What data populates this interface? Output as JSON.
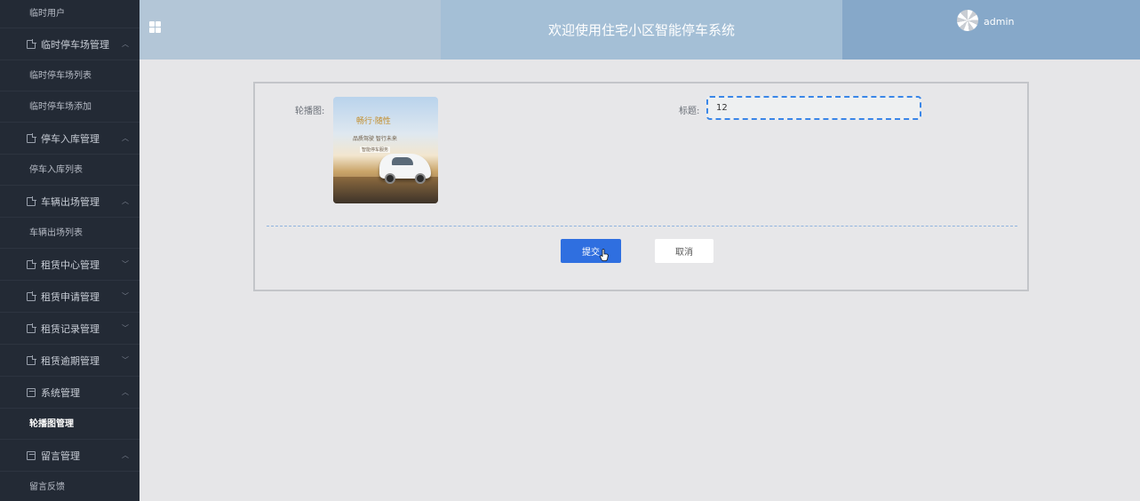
{
  "sidebar": {
    "top_item": "临时用户",
    "groups": [
      {
        "label": "临时停车场管理",
        "expanded": true,
        "icon": "document-icon",
        "items": [
          "临时停车场列表",
          "临时停车场添加"
        ]
      },
      {
        "label": "停车入库管理",
        "expanded": true,
        "icon": "document-icon",
        "items": [
          "停车入库列表"
        ]
      },
      {
        "label": "车辆出场管理",
        "expanded": true,
        "icon": "document-icon",
        "items": [
          "车辆出场列表"
        ]
      },
      {
        "label": "租赁中心管理",
        "expanded": false,
        "icon": "document-icon",
        "items": []
      },
      {
        "label": "租赁申请管理",
        "expanded": false,
        "icon": "document-icon",
        "items": []
      },
      {
        "label": "租赁记录管理",
        "expanded": false,
        "icon": "document-icon",
        "items": []
      },
      {
        "label": "租赁逾期管理",
        "expanded": false,
        "icon": "document-icon",
        "items": []
      },
      {
        "label": "系统管理",
        "expanded": true,
        "icon": "picture-icon",
        "items": [
          "轮播图管理"
        ]
      },
      {
        "label": "留言管理",
        "expanded": true,
        "icon": "picture-icon",
        "items": [
          "留言反馈"
        ]
      }
    ],
    "active_item": "轮播图管理"
  },
  "header": {
    "title": "欢迎使用住宅小区智能停车系统",
    "username": "admin",
    "menu_icon": "grid-icon",
    "colors": {
      "left": "#b3c6d7",
      "middle": "#a4bfd6",
      "right": "#86a8c9"
    }
  },
  "form": {
    "carousel_label": "轮播图:",
    "carousel_image": {
      "headline": "畅行·随性",
      "line1": "品质驾驶 智行未来",
      "line2": "智能停车服务"
    },
    "title_label": "标题:",
    "title_value": "12",
    "submit_label": "提交",
    "cancel_label": "取消",
    "accent_color": "#2f6fe0"
  }
}
